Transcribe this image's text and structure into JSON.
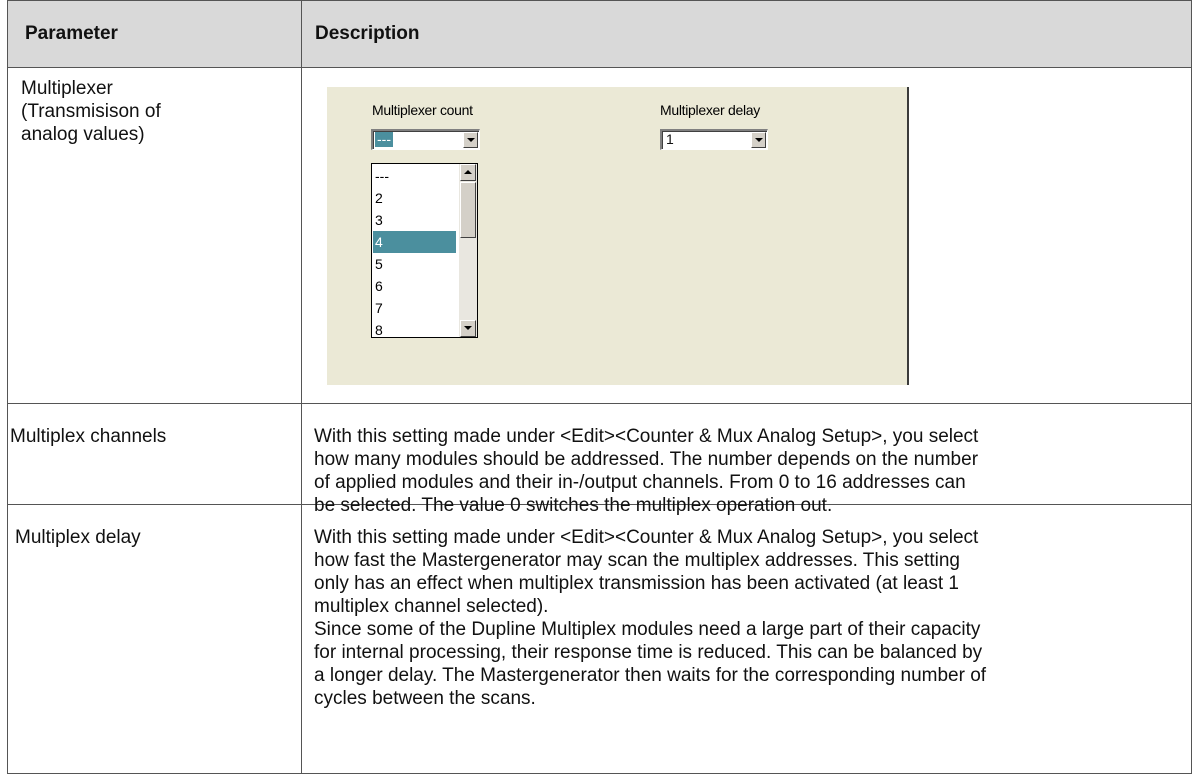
{
  "header": {
    "parameter": "Parameter",
    "description": "Description"
  },
  "rows": [
    {
      "parameter_lines": [
        "Multiplexer",
        "(Transmisison of",
        "analog values)"
      ],
      "dialog": {
        "count_label": "Multiplexer count",
        "count_value": "---",
        "delay_label": "Multiplexer delay",
        "delay_value": "1",
        "count_options": [
          "---",
          "2",
          "3",
          "4",
          "5",
          "6",
          "7",
          "8"
        ],
        "selected_option": "4"
      }
    },
    {
      "parameter": "Multiplex channels",
      "description_lines": [
        "With this setting made under <Edit><Counter & Mux Analog Setup>, you select",
        "how many modules should be addressed. The number depends on the number",
        "of applied modules  and their  in-/output channels. From 0 to 16 addresses can",
        "be selected. The value 0 switches the multiplex operation out."
      ]
    },
    {
      "parameter": "Multiplex delay",
      "description_lines": [
        "With this setting made under <Edit><Counter & Mux Analog Setup>, you select",
        "how fast the Mastergenerator may scan the multiplex addresses. This setting",
        "only has an effect when multiplex transmission has been activated (at least 1",
        "multiplex channel selected).",
        "Since some of the Dupline Multiplex modules need a large part of their capacity",
        "for internal processing, their response time is reduced. This can be balanced by",
        "a longer delay. The Mastergenerator then waits for the corresponding number of",
        "cycles between the scans."
      ]
    }
  ],
  "colors": {
    "dialog_background": "#ebe9d6",
    "selection": "#4b8f9e",
    "header_background": "#d9d9d9"
  }
}
